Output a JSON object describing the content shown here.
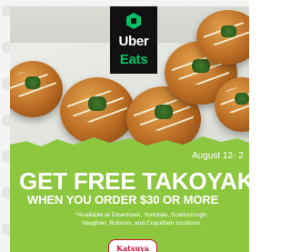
{
  "brand": {
    "logo_line1": "Uber",
    "logo_line2": "Eats",
    "logo_background": "#111111",
    "eats_color": "#06c167",
    "icon_name": "uber-eats-logo-icon"
  },
  "promo": {
    "date_range": "August 12- 2",
    "headline": "GET FREE TAKOYAK",
    "subheadline": "WHEN YOU ORDER $30 OR MORE",
    "disclaimer_lines": [
      "*Available at Downtown, Yorkdale, Scarborough,",
      "Vaughan, Robson, and Coquitlam locations."
    ],
    "background_color": "#8dc63f"
  },
  "restaurant": {
    "logo_text": "Katsuya",
    "logo_color": "#c8102e"
  },
  "image": {
    "subject": "takoyaki-photo"
  }
}
